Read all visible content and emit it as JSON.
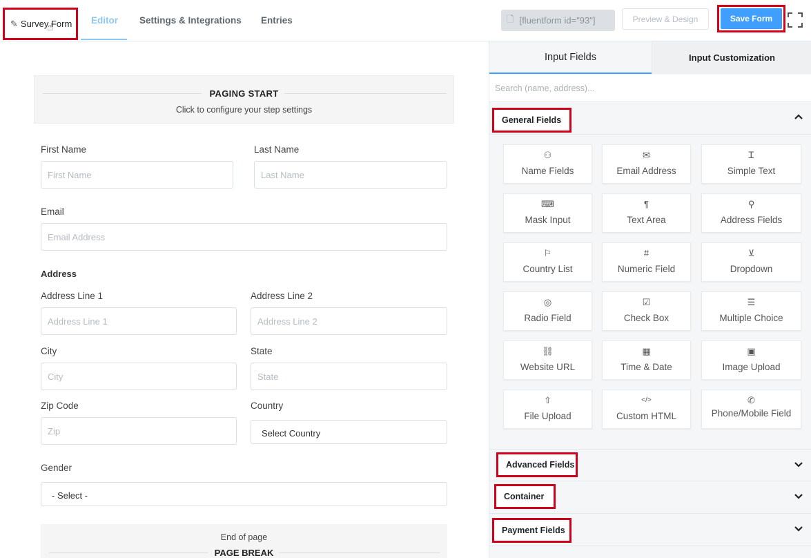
{
  "header": {
    "form_title": "Survey Form",
    "tabs": [
      "Editor",
      "Settings & Integrations",
      "Entries"
    ],
    "active_tab": "Editor",
    "shortcode": "[fluentform id=\"93\"]",
    "preview_label": "Preview & Design",
    "save_label": "Save Form",
    "colors": {
      "accent": "#409eff",
      "highlight": "#d0021b"
    }
  },
  "editor": {
    "paging_start": {
      "title": "PAGING START",
      "subtitle": "Click to configure your step settings"
    },
    "first_name": {
      "label": "First Name",
      "placeholder": "First Name"
    },
    "last_name": {
      "label": "Last Name",
      "placeholder": "Last Name"
    },
    "email": {
      "label": "Email",
      "placeholder": "Email Address"
    },
    "address": {
      "heading": "Address",
      "line1": {
        "label": "Address Line 1",
        "placeholder": "Address Line 1"
      },
      "line2": {
        "label": "Address Line 2",
        "placeholder": "Address Line 2"
      },
      "city": {
        "label": "City",
        "placeholder": "City"
      },
      "state": {
        "label": "State",
        "placeholder": "State"
      },
      "zip": {
        "label": "Zip Code",
        "placeholder": "Zip"
      },
      "country": {
        "label": "Country",
        "value": "Select Country"
      }
    },
    "gender": {
      "label": "Gender",
      "value": "- Select -"
    },
    "page_break": {
      "end_text": "End of page",
      "title": "PAGE BREAK"
    }
  },
  "panel": {
    "tabs": [
      "Input Fields",
      "Input Customization"
    ],
    "active_tab": "Input Fields",
    "search_placeholder": "Search (name, address)...",
    "sections": [
      "General Fields",
      "Advanced Fields",
      "Container",
      "Payment Fields"
    ],
    "general_fields": [
      {
        "label": "Name Fields",
        "icon": "user-icon"
      },
      {
        "label": "Email Address",
        "icon": "envelope-icon"
      },
      {
        "label": "Simple Text",
        "icon": "text-cursor-icon"
      },
      {
        "label": "Mask Input",
        "icon": "keyboard-icon"
      },
      {
        "label": "Text Area",
        "icon": "paragraph-icon"
      },
      {
        "label": "Address Fields",
        "icon": "map-pin-icon"
      },
      {
        "label": "Country List",
        "icon": "flag-icon"
      },
      {
        "label": "Numeric Field",
        "icon": "hash-icon"
      },
      {
        "label": "Dropdown",
        "icon": "dropdown-icon"
      },
      {
        "label": "Radio Field",
        "icon": "radio-icon"
      },
      {
        "label": "Check Box",
        "icon": "checkbox-icon"
      },
      {
        "label": "Multiple Choice",
        "icon": "list-icon"
      },
      {
        "label": "Website URL",
        "icon": "link-icon"
      },
      {
        "label": "Time & Date",
        "icon": "calendar-icon"
      },
      {
        "label": "Image Upload",
        "icon": "image-icon"
      },
      {
        "label": "File Upload",
        "icon": "upload-icon"
      },
      {
        "label": "Custom HTML",
        "icon": "code-icon"
      },
      {
        "label": "Phone/Mobile Field",
        "icon": "phone-icon"
      }
    ]
  }
}
